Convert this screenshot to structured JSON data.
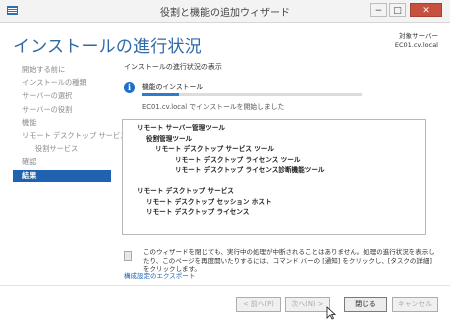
{
  "window": {
    "title": "役割と機能の追加ウィザード",
    "controls": {
      "minimize": "−",
      "maximize": "□",
      "close": "✕"
    }
  },
  "header": {
    "page_title": "インストールの進行状況",
    "target_label": "対象サーバー",
    "target_server": "EC01.cv.local"
  },
  "sidebar": {
    "items": [
      {
        "label": "開始する前に",
        "active": false,
        "sub": false
      },
      {
        "label": "インストールの種類",
        "active": false,
        "sub": false
      },
      {
        "label": "サーバーの選択",
        "active": false,
        "sub": false
      },
      {
        "label": "サーバーの役割",
        "active": false,
        "sub": false
      },
      {
        "label": "機能",
        "active": false,
        "sub": false
      },
      {
        "label": "リモート デスクトップ サービス",
        "active": false,
        "sub": false
      },
      {
        "label": "役割サービス",
        "active": false,
        "sub": true
      },
      {
        "label": "確認",
        "active": false,
        "sub": false
      },
      {
        "label": "結果",
        "active": true,
        "sub": false
      }
    ]
  },
  "main": {
    "section_label": "インストールの進行状況の表示",
    "progress": {
      "label": "機能のインストール",
      "status": "EC01.cv.local でインストールを開始しました",
      "fraction": 0.17
    },
    "features": [
      {
        "label": "リモート サーバー管理ツール",
        "indent": 0
      },
      {
        "label": "役割管理ツール",
        "indent": 1
      },
      {
        "label": "リモート デスクトップ サービス ツール",
        "indent": 2
      },
      {
        "label": "リモート デスクトップ ライセンス ツール",
        "indent": 3
      },
      {
        "label": "リモート デスクトップ ライセンス診断機能ツール",
        "indent": 3
      },
      {
        "label": "",
        "indent": 0
      },
      {
        "label": "リモート デスクトップ サービス",
        "indent": 0
      },
      {
        "label": "リモート デスクトップ セッション ホスト",
        "indent": 1
      },
      {
        "label": "リモート デスクトップ ライセンス",
        "indent": 1
      }
    ],
    "notice": "このウィザードを閉じても、実行中の処理が中断されることはありません。処理の進行状況を表示したり、このページを再度開いたりするには、コマンド バーの [通知] をクリックし、[タスクの詳細] をクリックします。",
    "export_link": "構成設定のエクスポート"
  },
  "footer": {
    "prev": "< 前へ(P)",
    "next": "次へ(N) >",
    "close": "閉じる",
    "cancel": "キャンセル"
  },
  "colors": {
    "accent": "#1e62b0",
    "title_blue": "#2f6aa8",
    "close_button": "#c7503f",
    "progress": "#2c7ec8"
  }
}
